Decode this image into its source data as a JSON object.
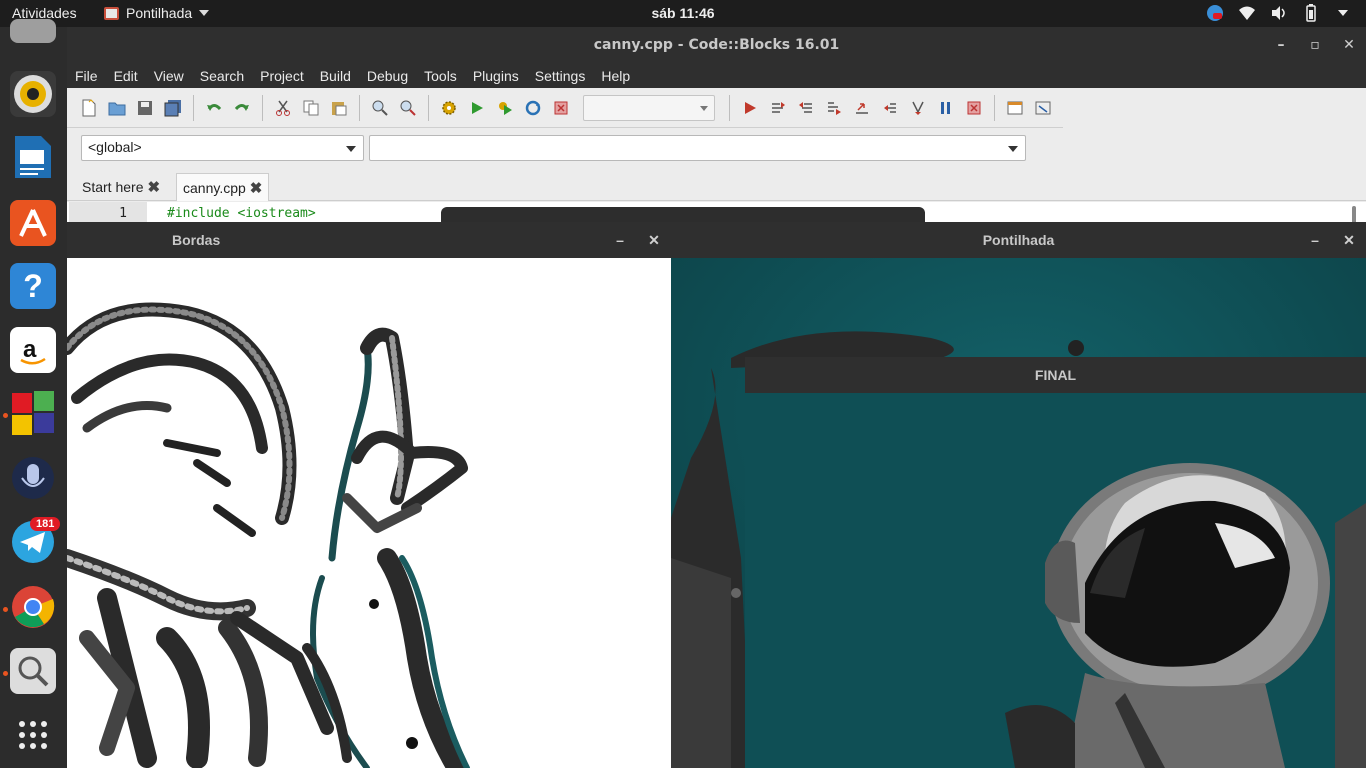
{
  "topbar": {
    "activities": "Atividades",
    "app_menu": "Pontilhada",
    "clock": "sáb 11:46"
  },
  "dock": {
    "telegram_badge": "181",
    "items": [
      "rhythmbox-icon",
      "libreoffice-impress-icon",
      "ubuntu-software-icon",
      "help-icon",
      "amazon-icon",
      "app-grid-icon",
      "voice-icon",
      "telegram-icon",
      "chrome-icon",
      "search-tool-icon",
      "show-apps-icon"
    ]
  },
  "codeblocks": {
    "title": "canny.cpp - Code::Blocks 16.01",
    "menu": [
      "File",
      "Edit",
      "View",
      "Search",
      "Project",
      "Build",
      "Debug",
      "Tools",
      "Plugins",
      "Settings",
      "Help"
    ],
    "scope_combo": "<global>",
    "symbol_combo": "",
    "tabs": [
      {
        "label": "Start here",
        "close": "✖"
      },
      {
        "label": "canny.cpp",
        "close": "✖"
      }
    ],
    "editor": {
      "line_number": "1",
      "code": "#include <iostream>"
    }
  },
  "windows": {
    "bordas_title": "Bordas",
    "pontilhada_title": "Pontilhada",
    "final_title": "FINAL",
    "minimize": "–",
    "close": "✕"
  },
  "colors": {
    "topbar": "#1d1d1d",
    "dock": "#2c2c2c",
    "titlebar": "#2f2f2f",
    "teal_background": "#0f5257",
    "accent": "#e95420"
  }
}
